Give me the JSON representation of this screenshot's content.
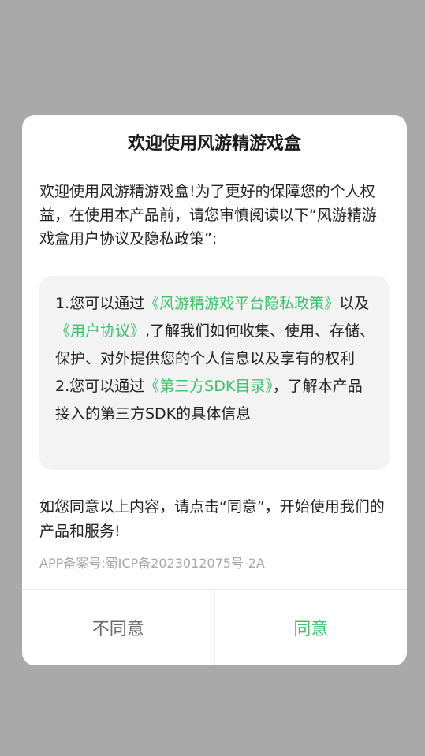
{
  "dialog": {
    "title": "欢迎使用风游精游戏盒",
    "intro": "欢迎使用风游精游戏盒!为了更好的保障您的个人权益，在使用本产品前，请您审慎阅读以下“风游精游戏盒用户协议及隐私政策”:",
    "notice": {
      "item1_prefix": "1.您可以通过",
      "privacy_link": "《风游精游戏平台隐私政策》",
      "item1_mid": "以及",
      "user_agreement_link": "《用户协议》",
      "item1_suffix": ",了解我们如何收集、使用、存储、保护、对外提供您的个人信息以及享有的权利",
      "item2_prefix": "2.您可以通过",
      "sdk_link": "《第三方SDK目录》",
      "item2_suffix": "，了解本产品接入的第三方SDK的具体信息"
    },
    "consent": "如您同意以上内容，请点击“同意”，开始使用我们的产品和服务!",
    "record": "APP备案号:蜀ICP备2023012075号-2A",
    "buttons": {
      "disagree": "不同意",
      "agree": "同意"
    }
  },
  "colors": {
    "accent": "#3dc36a",
    "backdrop": "#a9a9a9",
    "notice_bg": "#f3f3f3"
  }
}
